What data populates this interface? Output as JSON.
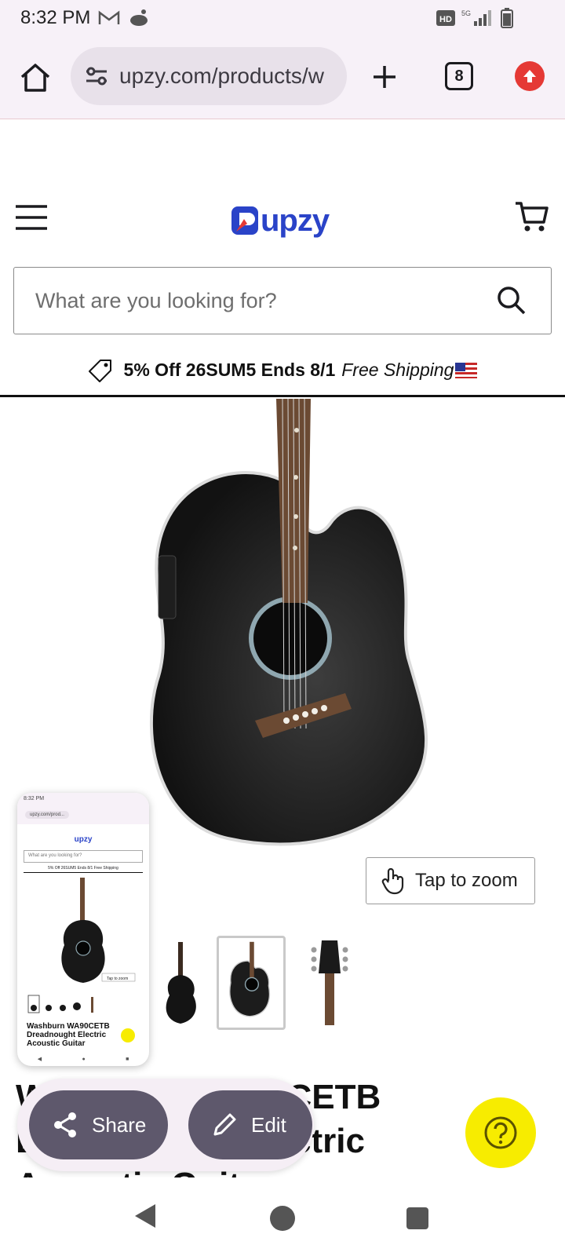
{
  "status_bar": {
    "time": "8:32 PM",
    "network": "5G",
    "hd_badge": "HD"
  },
  "browser": {
    "url": "upzy.com/products/w",
    "tab_count": "8"
  },
  "site": {
    "logo_text": "upzy",
    "search_placeholder": "What are you looking for?",
    "promo_bold": "5% Off 26SUM5 Ends 8/1",
    "promo_italic": "Free Shipping"
  },
  "product": {
    "zoom_label": "Tap to zoom",
    "title_lines": [
      "Washburn WA90CETB",
      "Dreadnought Electric",
      "Acoustic Guitar"
    ],
    "thumbnails": [
      "full-back-view",
      "body-closeup",
      "headstock"
    ],
    "selected_thumbnail": 1
  },
  "preview": {
    "status_time": "8:32 PM",
    "url": "upzy.com/prod...",
    "logo": "upzy",
    "search": "What are you looking for?",
    "promo": "5% Off 26SUM5 Ends 8/1 Free Shipping",
    "zoom": "Tap to zoom",
    "title": "Washburn WA90CETB Dreadnought Electric Acoustic Guitar"
  },
  "actions": {
    "share_label": "Share",
    "edit_label": "Edit"
  },
  "colors": {
    "brand": "#2a43c8",
    "help_button": "#f7ec00",
    "action_button": "#5e586c"
  }
}
